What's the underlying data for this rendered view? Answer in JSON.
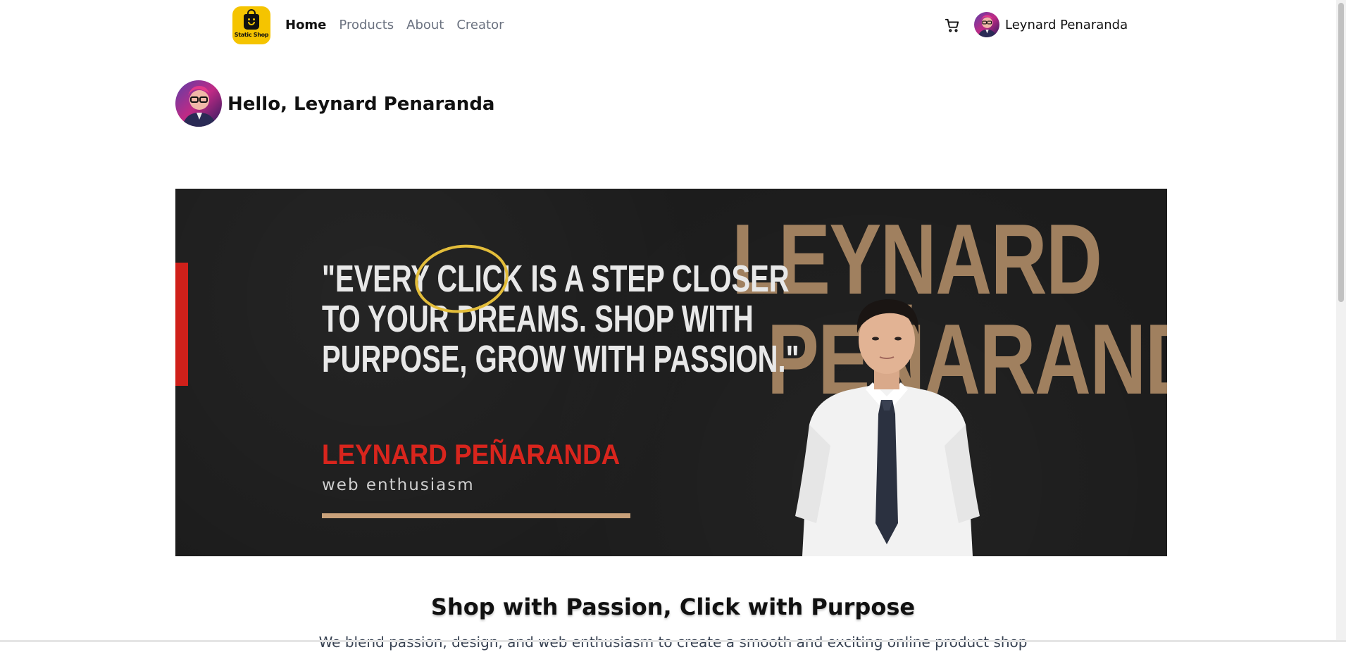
{
  "navbar": {
    "logo_text": "Static Shop",
    "links": [
      {
        "label": "Home",
        "active": true
      },
      {
        "label": "Products",
        "active": false
      },
      {
        "label": "About",
        "active": false
      },
      {
        "label": "Creator",
        "active": false
      }
    ],
    "cart_icon": "cart-icon",
    "username": "Leynard Penaranda"
  },
  "greeting": {
    "text": "Hello, Leynard Penaranda"
  },
  "banner": {
    "quote_lines": [
      "\"EVERY CLICK IS A STEP CLOSER",
      "TO YOUR DREAMS. SHOP WITH",
      "PURPOSE, GROW WITH PASSION.\""
    ],
    "big_name_line1": "LEYNARD",
    "big_name_line2": "PEÑARANDA",
    "sub_name": "LEYNARD PEÑARANDA",
    "sub_tag": "web enthusiasm"
  },
  "section": {
    "title": "Shop with Passion, Click with Purpose",
    "subtitle": "We blend passion, design, and web enthusiasm to create a smooth and exciting online product shop"
  },
  "colors": {
    "logo_bg": "#f5c400",
    "banner_bg": "#1c1c1c",
    "banner_gold": "#a0805f",
    "banner_red": "#d8251d",
    "circle_gold": "#e3bd3a"
  }
}
